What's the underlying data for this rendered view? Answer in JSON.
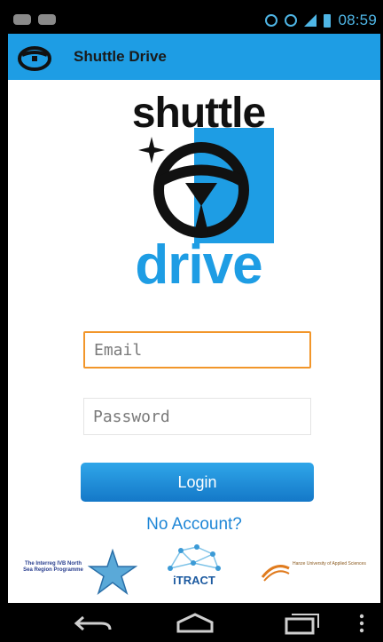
{
  "status_bar": {
    "time": "08:59"
  },
  "app_bar": {
    "title": "Shuttle Drive",
    "icon": "steering-wheel-icon"
  },
  "brand": {
    "word_top": "shuttle",
    "word_bottom": "drive"
  },
  "form": {
    "email_placeholder": "Email",
    "password_placeholder": "Password",
    "login_label": "Login",
    "no_account_label": "No Account?"
  },
  "partners": {
    "interreg": "The Interreg IVB North Sea Region Programme",
    "itract": "iTRACT",
    "hanze": "Hanze University of Applied Sciences"
  },
  "colors": {
    "accent": "#1e9de4",
    "focus": "#f2962a",
    "link": "#1e86d6"
  },
  "nav": {
    "back_icon": "back-icon",
    "home_icon": "home-icon",
    "recents_icon": "recents-icon",
    "menu_icon": "overflow-menu-icon"
  }
}
